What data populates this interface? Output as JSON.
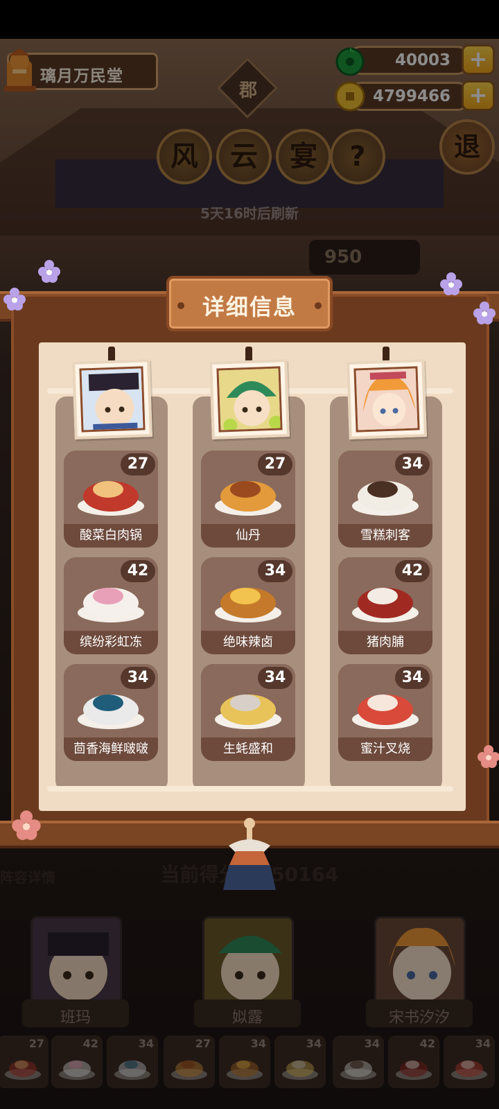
{
  "hud": {
    "player_name": "璃月万民堂",
    "jade_amount": "40003",
    "coin_amount": "4799466",
    "plus_label": "+"
  },
  "header": {
    "seal_text": "郡",
    "title_chars": [
      "风",
      "云",
      "宴",
      "?"
    ],
    "exit_label": "退",
    "refresh_text": "5天16时后刷新",
    "score_pill": "950"
  },
  "panel": {
    "title": "详细信息",
    "columns": [
      {
        "dishes": [
          {
            "name": "酸菜白肉锅",
            "level": "27"
          },
          {
            "name": "缤纷彩虹冻",
            "level": "42"
          },
          {
            "name": "茴香海鲜啵啵",
            "level": "34"
          }
        ]
      },
      {
        "dishes": [
          {
            "name": "仙丹",
            "level": "27"
          },
          {
            "name": "绝味辣卤",
            "level": "34"
          },
          {
            "name": "生蚝盛和",
            "level": "34"
          }
        ]
      },
      {
        "dishes": [
          {
            "name": "雪糕刺客",
            "level": "34"
          },
          {
            "name": "猪肉脯",
            "level": "42"
          },
          {
            "name": "蜜汁叉烧",
            "level": "34"
          }
        ]
      }
    ]
  },
  "bottom": {
    "lineup_label": "阵容详情",
    "score_label": "当前得分：950164",
    "characters": [
      {
        "name": "班玛"
      },
      {
        "name": "姒露"
      },
      {
        "name": "宋书汐汐"
      }
    ],
    "mini_levels": [
      "27",
      "42",
      "34",
      "27",
      "34",
      "34",
      "34",
      "42",
      "34"
    ]
  },
  "colors": {
    "panel_wood": "#7a4522",
    "panel_paper": "#f0dcc4",
    "column_bg": "#a88f7d",
    "dish_card": "#6d4a3c",
    "badge": "#55372c",
    "gold": "#f2a51c"
  }
}
